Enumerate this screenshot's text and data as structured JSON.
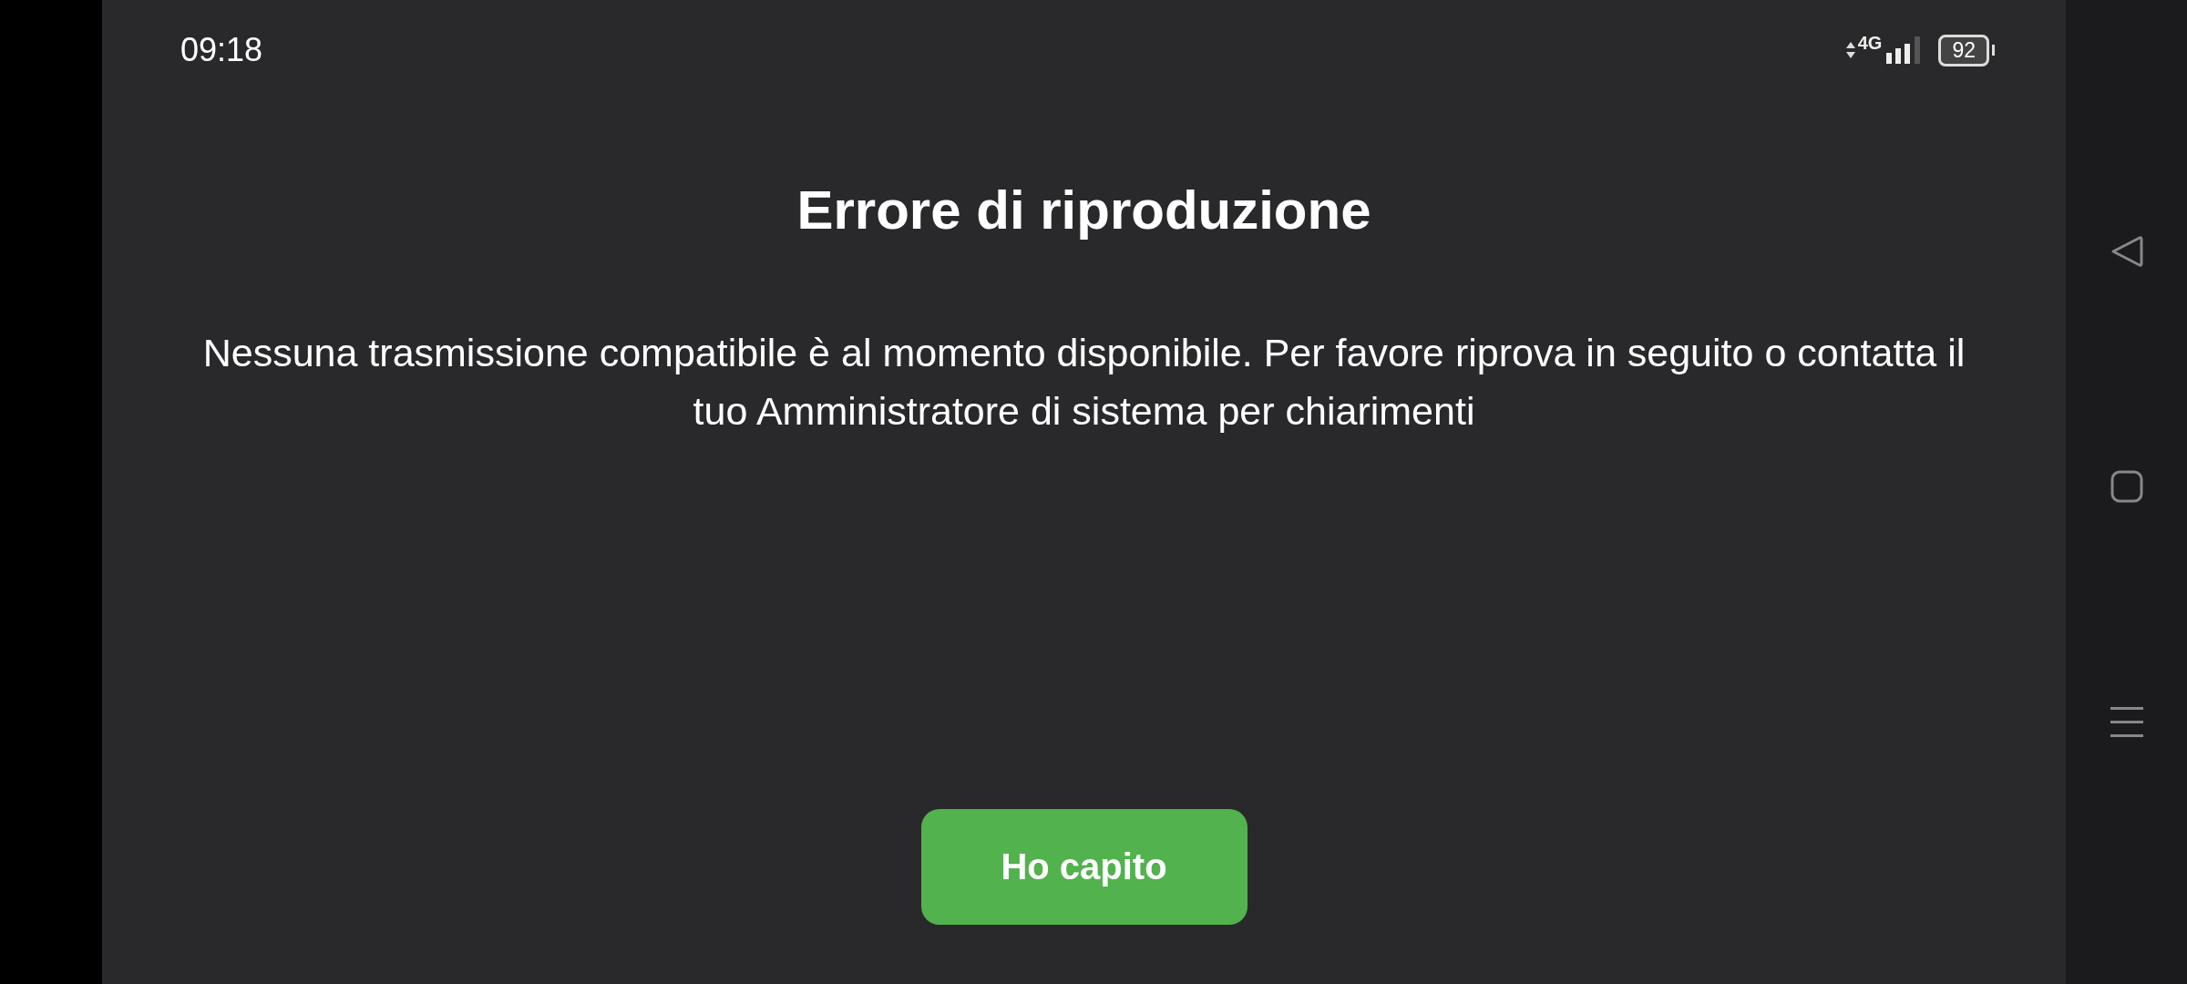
{
  "status_bar": {
    "time": "09:18",
    "network": "4G",
    "battery": "92"
  },
  "dialog": {
    "title": "Errore di riproduzione",
    "message": "Nessuna trasmissione compatibile è al momento disponibile. Per favore riprova in seguito o contatta il tuo Amministratore di sistema per chiarimenti",
    "button": "Ho capito"
  }
}
